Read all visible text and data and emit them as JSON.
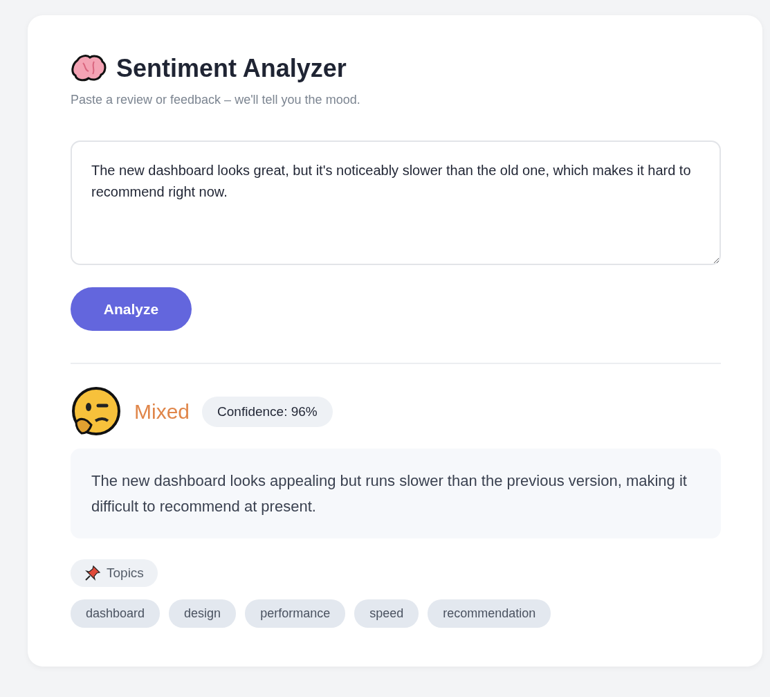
{
  "header": {
    "title": "Sentiment Analyzer",
    "subtitle": "Paste a review or feedback – we'll tell you the mood."
  },
  "input": {
    "value": "The new dashboard looks great, but it's noticeably slower than the old one, which makes it hard to recommend right now."
  },
  "analyze_button": {
    "label": "Analyze"
  },
  "result": {
    "kind": "mixed",
    "label": "Mixed",
    "confidence": "Confidence: 96%",
    "summary": "The new dashboard looks appealing but runs slower than the previous version, making it difficult to recommend at present."
  },
  "topics": {
    "label": "Topics",
    "tags": [
      "dashboard",
      "design",
      "performance",
      "speed",
      "recommendation"
    ]
  }
}
